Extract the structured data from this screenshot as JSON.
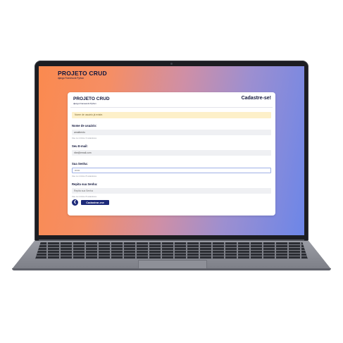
{
  "app": {
    "logo_title": "PROJETO CRUD",
    "logo_subtitle": "django Framework Python"
  },
  "card": {
    "logo_title": "PROJETO CRUD",
    "logo_subtitle": "django Framework Python",
    "title": "Cadastre-se!",
    "alert": "Nome de usuário já existe.",
    "fields": {
      "username": {
        "label": "Nome de usuário:",
        "value": "amalbento",
        "help": "Use no mínimo 3 caracteres"
      },
      "email": {
        "label": "Seu E-mail:",
        "value": "ribe@email.com"
      },
      "password": {
        "label": "Sua Senha:",
        "value": "••••••",
        "help": "Use no mínimo 8 caracteres"
      },
      "password_confirm": {
        "label": "Repita sua Senha:",
        "placeholder": "Repita sua Senha",
        "help": "Use no mínimo 8 caracteres"
      }
    },
    "back_icon": "chevron-left-icon",
    "submit_label": "Cadastrar-me"
  },
  "colors": {
    "navy": "#1d2a7a",
    "gradient_start": "#fb8a4f",
    "gradient_end": "#6c86e8",
    "alert_bg": "#fdf0c9"
  }
}
